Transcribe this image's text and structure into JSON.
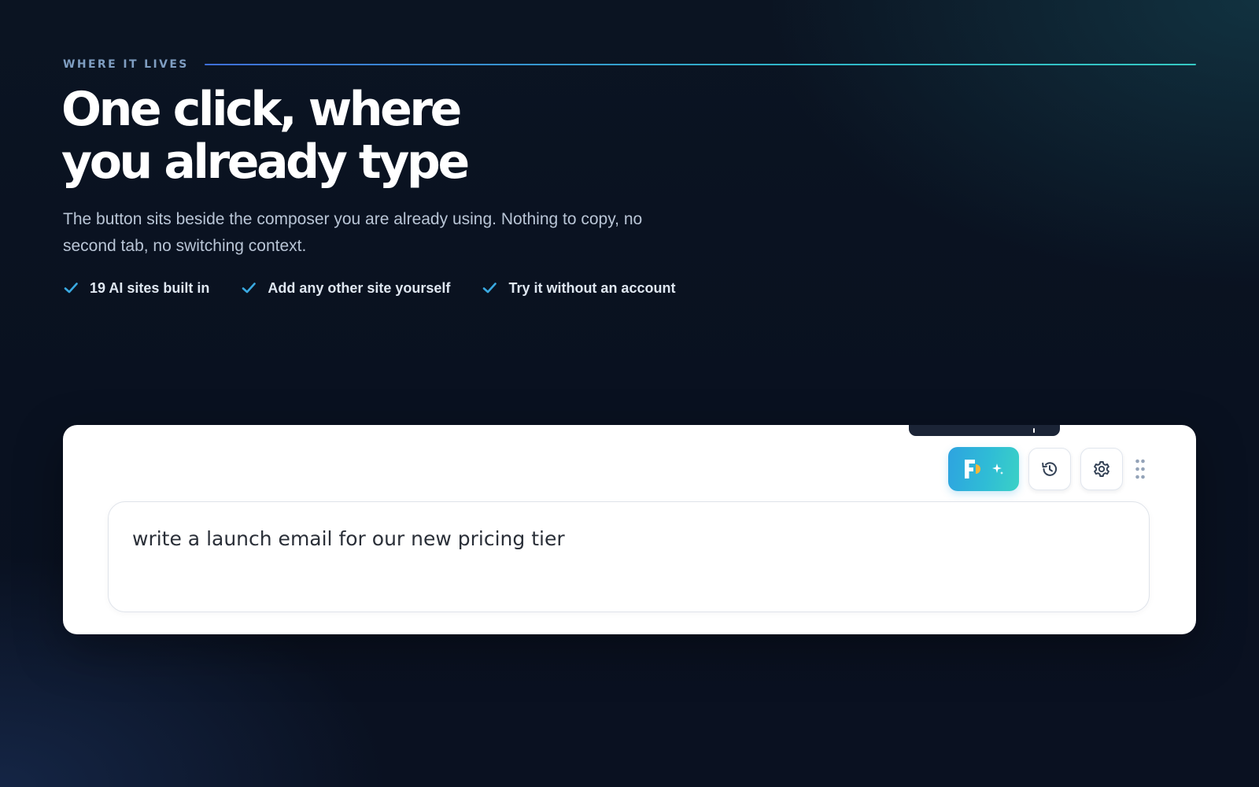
{
  "section": {
    "eyebrow": "WHERE IT LIVES",
    "headline_line1": "One click, where",
    "headline_line2": "you already type",
    "subcopy": "The button sits beside the composer you are already using. Nothing to copy, no second tab, no switching context.",
    "features": [
      {
        "label": "19 AI sites built in",
        "icon": "check-icon"
      },
      {
        "label": "Add any other site yourself",
        "icon": "check-icon"
      },
      {
        "label": "Try it without an account",
        "icon": "check-icon"
      }
    ]
  },
  "demo": {
    "composer_text": "write a launch email for our new pricing tier",
    "toolbar": {
      "extension_button_icons": [
        "extension-logo-icon",
        "sparkle-icon"
      ],
      "history_icon": "history-icon",
      "settings_icon": "gear-icon",
      "drag_icon": "drag-handle-icon"
    }
  },
  "colors": {
    "background": "#0a1220",
    "accent_teal": "#2fbcd6",
    "accent_blue": "#2ea3e0",
    "check": "#3aa9e0",
    "card": "#ffffff"
  }
}
